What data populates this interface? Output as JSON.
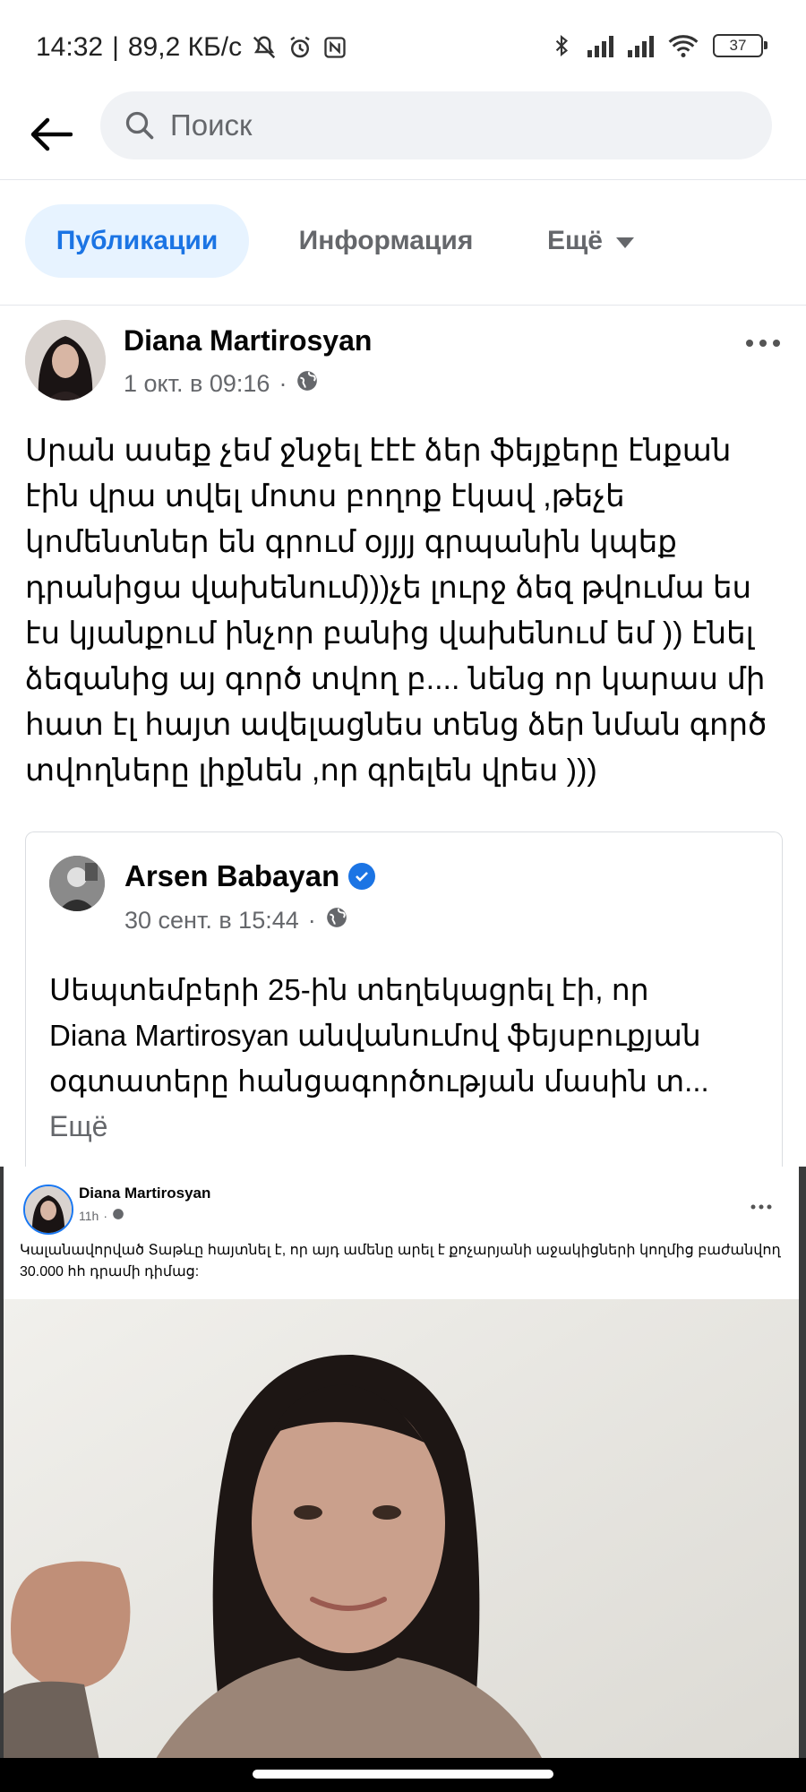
{
  "status_bar": {
    "time": "14:32",
    "network_speed": "89,2 КБ/с",
    "battery": "37"
  },
  "search": {
    "placeholder": "Поиск"
  },
  "tabs": [
    {
      "label": "Публикации",
      "active": true
    },
    {
      "label": "Информация",
      "active": false
    },
    {
      "label": "Ещё",
      "active": false
    }
  ],
  "post": {
    "author": "Diana Martirosyan",
    "timestamp": "1 окт. в 09:16",
    "text_lines": [
      "Սրան ասեք չեմ ջնջել էէէ ձեր ֆեյքերը էնքան",
      "էին վրա տվել մոտս բողոք էկավ ,թեչե",
      "կոմենտներ են գրում օյյյյ գրպանին կպեք",
      "դրանիցա վախենում)))չե լուրջ ձեզ թվումա ես",
      "էս կյանքում ինչոր բանից վախենում եմ )) էնել",
      "ձեզանից այ գործ տվող  բ.... նենց որ կարաս մի",
      "հատ էլ հայտ ավելացնես տենց ձեր նման գործ",
      "տվողները լիքնեն ,որ գրելեն վրես )))"
    ]
  },
  "shared_post": {
    "author": "Arsen Babayan",
    "timestamp": "30 сент. в 15:44",
    "text_lines": [
      "Սեպտեմբերի 25-ին տեղեկացրել էի, որ",
      "Diana Martirosyan  անվանումով ֆեյսբուքյան",
      "օգտատերը հանցագործության մասին տ..."
    ],
    "see_more": "Ещё"
  },
  "embedded_post": {
    "author": "Diana Martirosyan",
    "timestamp": "11h",
    "text": "Կալանավորված Տաթևը  հայտնել է, որ այդ ամենը արել է քոչարյանի աջակիցների կողմից բաժանվող 30.000 հհ դրամի դիմաց:"
  },
  "colors": {
    "accent": "#1b74e4",
    "active_tab_bg": "#e7f3ff",
    "secondary_text": "#65676b"
  }
}
